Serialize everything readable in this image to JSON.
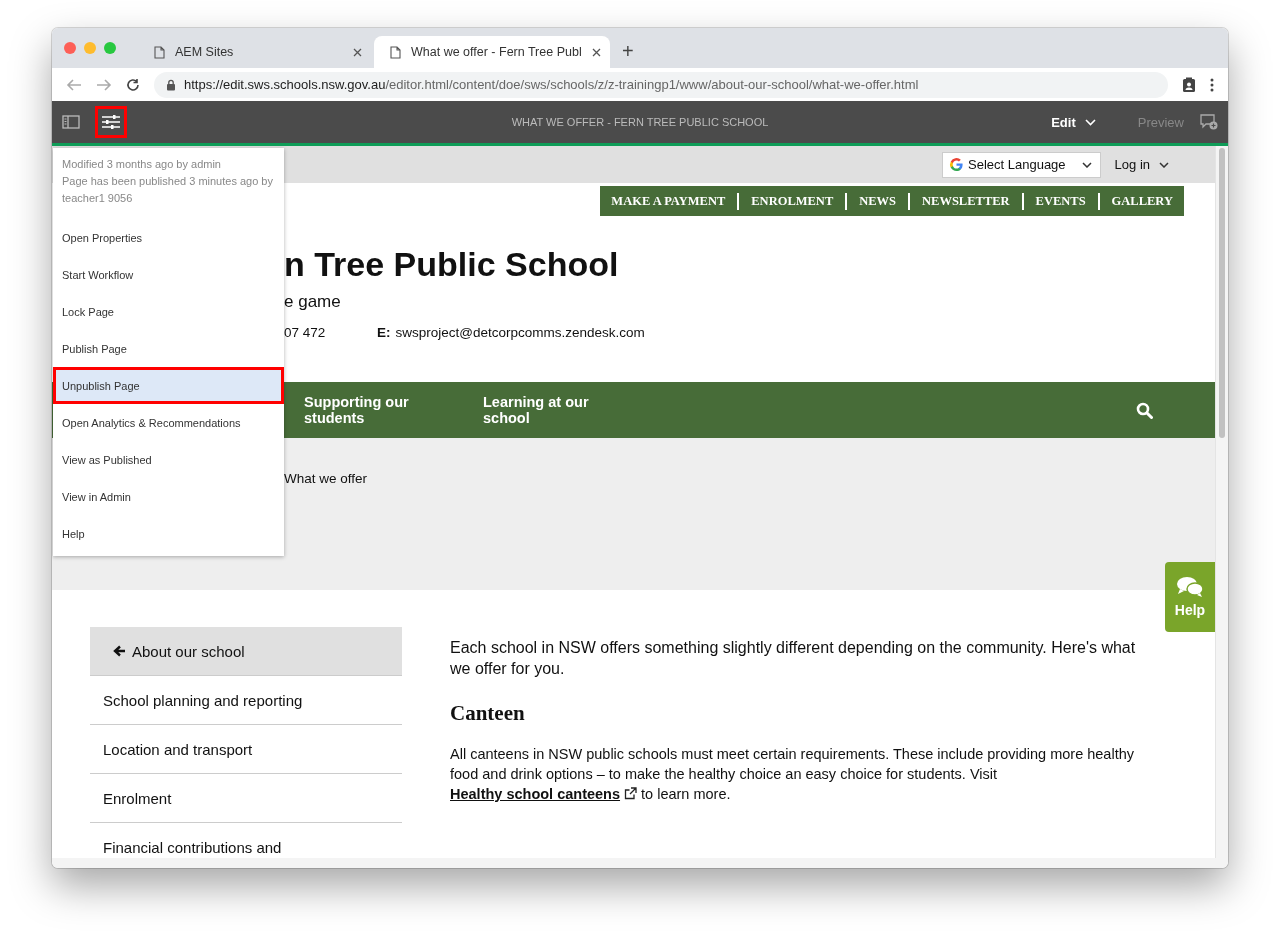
{
  "browser": {
    "tabs": [
      {
        "title": "AEM Sites",
        "selected": false
      },
      {
        "title": "What we offer - Fern Tree Publ",
        "selected": true
      }
    ],
    "new_tab": "+",
    "url_host": "https://edit.sws.schools.nsw.gov.au",
    "url_path": "/editor.html/content/doe/sws/schools/z/z-trainingp1/www/about-our-school/what-we-offer.html"
  },
  "editor_bar": {
    "page_info_highlighted": true,
    "title": "WHAT WE OFFER - FERN TREE PUBLIC SCHOOL",
    "mode": "Edit",
    "preview": "Preview"
  },
  "page_menu": {
    "info": [
      "Modified 3 months ago by admin",
      "Page has been published 3 minutes ago by teacher1 9056"
    ],
    "items": [
      {
        "label": "Open Properties",
        "selected": false
      },
      {
        "label": "Start Workflow",
        "selected": false
      },
      {
        "label": "Lock Page",
        "selected": false
      },
      {
        "label": "Publish Page",
        "selected": false
      },
      {
        "label": "Unpublish Page",
        "selected": true
      },
      {
        "label": "Open Analytics & Recommendations",
        "selected": false
      },
      {
        "label": "View as Published",
        "selected": false
      },
      {
        "label": "View in Admin",
        "selected": false
      },
      {
        "label": "Help",
        "selected": false
      }
    ]
  },
  "site": {
    "language": "Select Language",
    "login": "Log in",
    "quick_links": [
      "MAKE A PAYMENT",
      "ENROLMENT",
      "NEWS",
      "NEWSLETTER",
      "EVENTS",
      "GALLERY"
    ],
    "school_name": "n Tree Public School",
    "tagline": "e game",
    "phone": "07 472",
    "email_label": "E:",
    "email": "swsproject@detcorpcomms.zendesk.com",
    "nav": [
      "Supporting our students",
      "Learning at our school"
    ],
    "breadcrumb": "What we offer",
    "sidebar": {
      "back": "About our school",
      "items": [
        "School planning and reporting",
        "Location and transport",
        "Enrolment",
        "Financial contributions and"
      ]
    },
    "intro": "Each school in NSW offers something slightly different depending on the community. Here's what we offer for you.",
    "section_heading": "Canteen",
    "section_text": "All canteens in NSW public schools must meet certain requirements. These include providing more healthy food and drink options – to make the healthy choice an easy choice for students. Visit",
    "link": "Healthy school canteens",
    "after_link": "to learn more.",
    "help": "Help"
  }
}
